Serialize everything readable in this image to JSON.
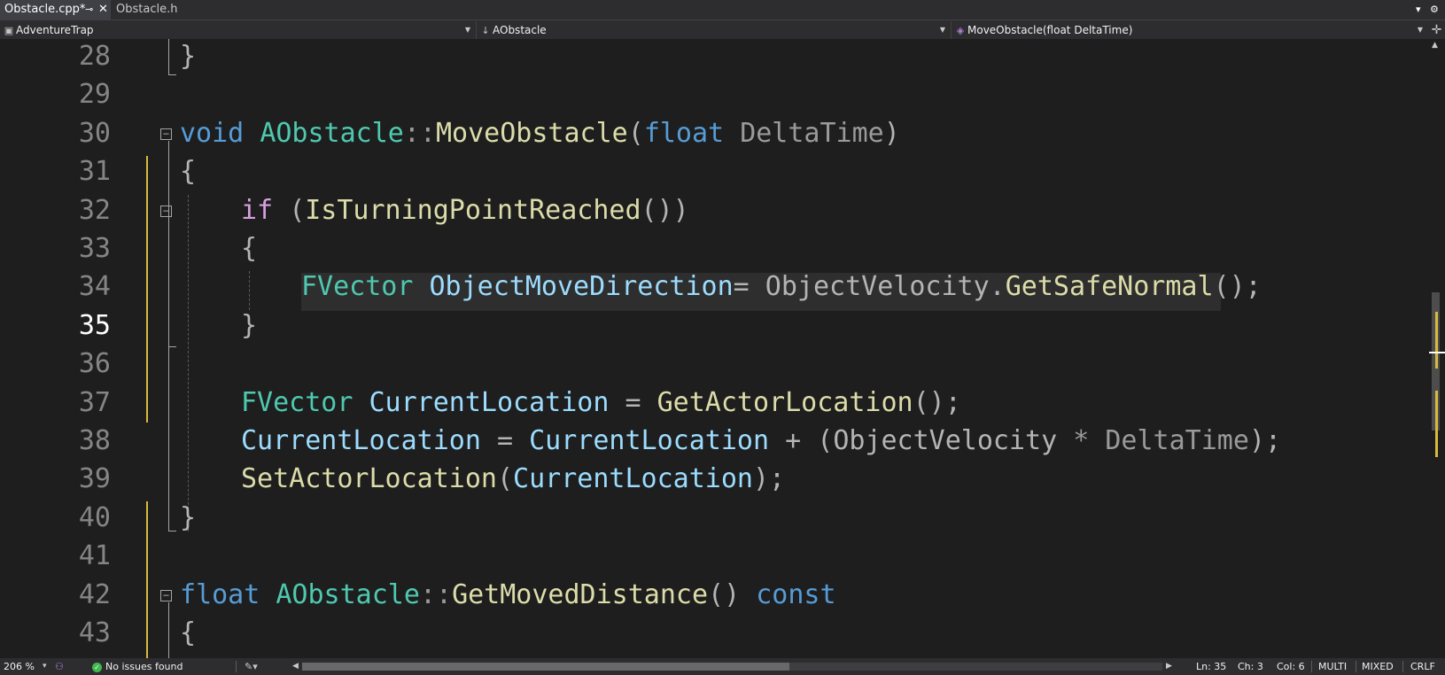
{
  "tabs": [
    {
      "label": "Obstacle.cpp*",
      "active": true,
      "pin_icon": "pin-icon",
      "close_icon": "close-icon"
    },
    {
      "label": "Obstacle.h",
      "active": false
    }
  ],
  "tabbar_right": {
    "dropdown_icon": "chevron-down-icon",
    "settings_icon": "gear-icon"
  },
  "navbar": {
    "project": "AdventureTrap",
    "scope": "AObstacle",
    "member": "MoveObstacle(float DeltaTime)"
  },
  "editor": {
    "current_line": 35,
    "lines": [
      {
        "n": "28",
        "text": "}"
      },
      {
        "n": "29",
        "text": ""
      },
      {
        "n": "30",
        "text": "void AObstacle::MoveObstacle(float DeltaTime)"
      },
      {
        "n": "31",
        "text": "{"
      },
      {
        "n": "32",
        "text": "if (IsTurningPointReached())"
      },
      {
        "n": "33",
        "text": "{"
      },
      {
        "n": "34",
        "text": "FVector ObjectMoveDirection= ObjectVelocity.GetSafeNormal();"
      },
      {
        "n": "35",
        "text": "}"
      },
      {
        "n": "36",
        "text": ""
      },
      {
        "n": "37",
        "text": "FVector CurrentLocation = GetActorLocation();"
      },
      {
        "n": "38",
        "text": "CurrentLocation = CurrentLocation + (ObjectVelocity * DeltaTime);"
      },
      {
        "n": "39",
        "text": "SetActorLocation(CurrentLocation);"
      },
      {
        "n": "40",
        "text": "}"
      },
      {
        "n": "41",
        "text": ""
      },
      {
        "n": "42",
        "text": "float AObstacle::GetMovedDistance() const"
      },
      {
        "n": "43",
        "text": "{"
      }
    ],
    "tokens": {
      "l30": [
        "void",
        "AObstacle",
        "::",
        "MoveObstacle",
        "(",
        "float",
        "DeltaTime",
        ")"
      ],
      "l32": [
        "if",
        "(",
        "IsTurningPointReached",
        "())"
      ],
      "l34": [
        "FVector",
        "ObjectMoveDirection",
        "=",
        "ObjectVelocity",
        ".",
        "GetSafeNormal",
        "();"
      ],
      "l37": [
        "FVector",
        "CurrentLocation",
        "=",
        "GetActorLocation",
        "();"
      ],
      "l38": [
        "CurrentLocation",
        "=",
        "CurrentLocation",
        "+",
        "(",
        "ObjectVelocity",
        "*",
        "DeltaTime",
        ");"
      ],
      "l39": [
        "SetActorLocation",
        "(",
        "CurrentLocation",
        ");"
      ],
      "l42": [
        "float",
        "AObstacle",
        "::",
        "GetMovedDistance",
        "()",
        "const"
      ]
    }
  },
  "statusbar": {
    "zoom": "206 %",
    "issues": "No issues found",
    "line": "Ln: 35",
    "ch": "Ch: 3",
    "col": "Col: 6",
    "mode1": "MULTI",
    "mode2": "MIXED",
    "eol": "CRLF"
  },
  "colors": {
    "keyword": "#569cd6",
    "type": "#4ec9b0",
    "function": "#dcdcaa",
    "variable": "#9cdcfe",
    "parameter": "#9a9a9a",
    "control": "#d8a0df",
    "change_marker": "#d7ba3d",
    "ok": "#3fb950"
  }
}
